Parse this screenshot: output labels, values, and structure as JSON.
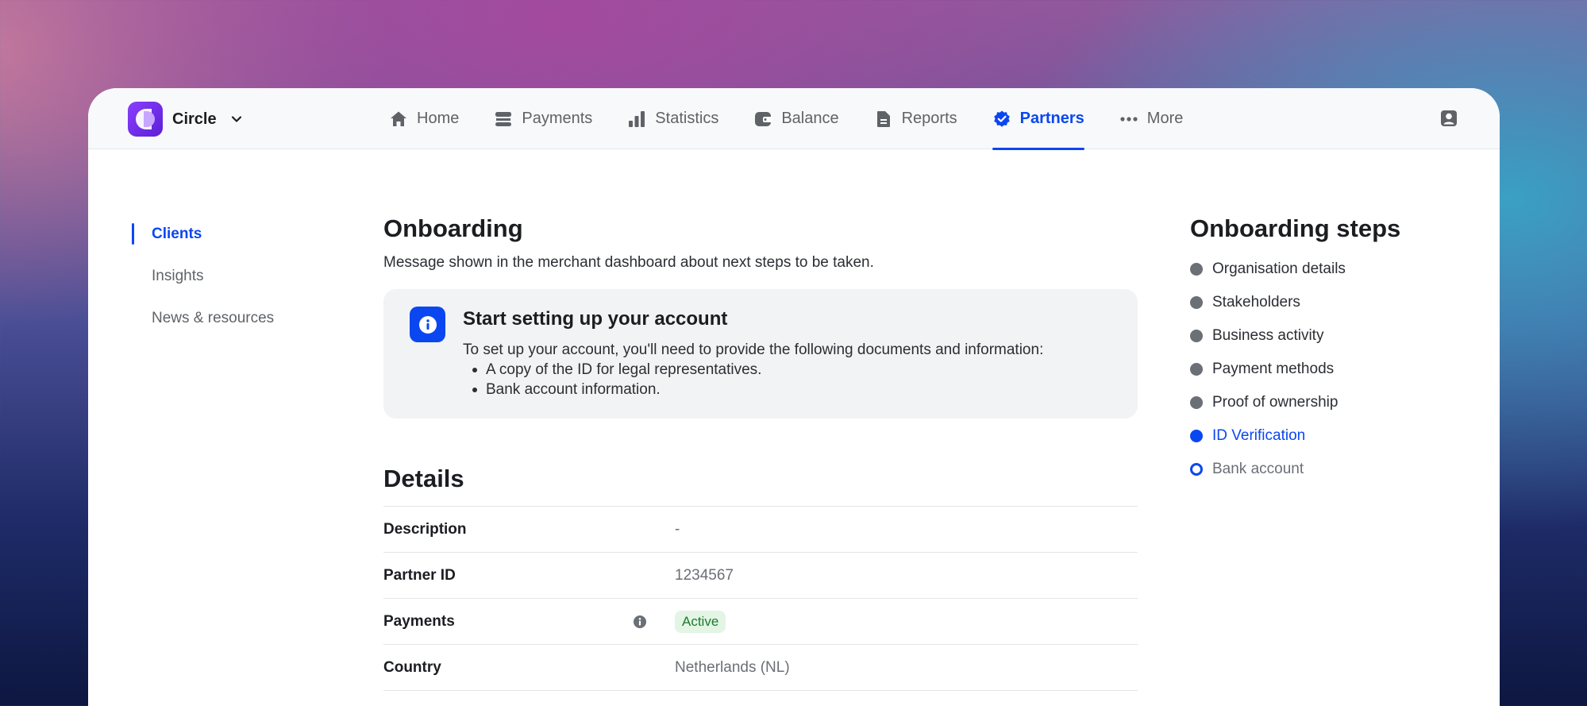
{
  "brand": {
    "name": "Circle",
    "logo_icon": "circle-logo-icon",
    "color": "#6b2ef0"
  },
  "nav": {
    "items": [
      {
        "label": "Home",
        "icon": "home-icon"
      },
      {
        "label": "Payments",
        "icon": "payments-icon"
      },
      {
        "label": "Statistics",
        "icon": "statistics-icon"
      },
      {
        "label": "Balance",
        "icon": "balance-icon"
      },
      {
        "label": "Reports",
        "icon": "reports-icon"
      },
      {
        "label": "Partners",
        "icon": "partners-badge-icon",
        "active": true
      },
      {
        "label": "More",
        "icon": "more-dots-icon"
      }
    ],
    "accent_color": "#0b47f0"
  },
  "sidebar": {
    "items": [
      {
        "label": "Clients",
        "active": true
      },
      {
        "label": "Insights"
      },
      {
        "label": "News & resources"
      }
    ]
  },
  "main": {
    "title": "Onboarding",
    "subtitle": "Message shown in the merchant dashboard about next steps to be taken.",
    "callout": {
      "icon": "info-icon",
      "title": "Start setting up your account",
      "text": "To set up your account, you'll need to provide the following documents and information:",
      "items": [
        "A copy of the ID for legal representatives.",
        "Bank account information."
      ]
    },
    "details_title": "Details",
    "details": [
      {
        "label": "Description",
        "value": "-"
      },
      {
        "label": "Partner ID",
        "value": "1234567"
      },
      {
        "label": "Payments",
        "value": "Active",
        "badge": true,
        "info_icon": "info-icon"
      },
      {
        "label": "Country",
        "value": "Netherlands (NL)"
      }
    ]
  },
  "steps": {
    "title": "Onboarding steps",
    "items": [
      {
        "label": "Organisation details",
        "state": "done"
      },
      {
        "label": "Stakeholders",
        "state": "done"
      },
      {
        "label": "Business activity",
        "state": "done"
      },
      {
        "label": "Payment methods",
        "state": "done"
      },
      {
        "label": "Proof of ownership",
        "state": "done"
      },
      {
        "label": "ID Verification",
        "state": "current"
      },
      {
        "label": "Bank account",
        "state": "pending"
      }
    ]
  }
}
